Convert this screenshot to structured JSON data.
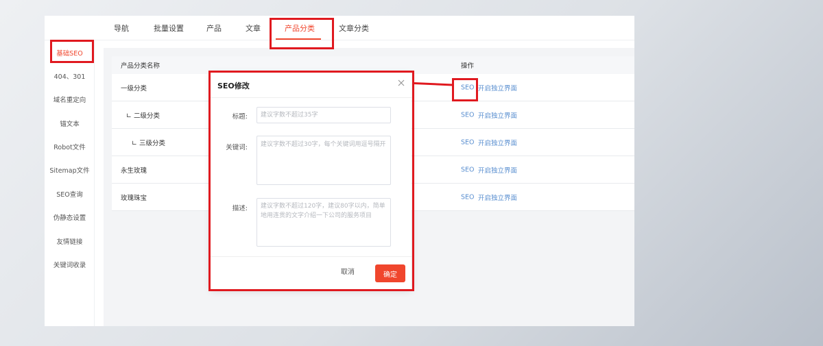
{
  "tabs": [
    {
      "label": "导航"
    },
    {
      "label": "批量设置"
    },
    {
      "label": "产品"
    },
    {
      "label": "文章"
    },
    {
      "label": "产品分类"
    },
    {
      "label": "文章分类"
    }
  ],
  "active_tab_index": 4,
  "sidebar": {
    "items": [
      {
        "label": "基础SEO"
      },
      {
        "label": "404、301"
      },
      {
        "label": "域名重定向"
      },
      {
        "label": "锚文本"
      },
      {
        "label": "Robot文件"
      },
      {
        "label": "Sitemap文件"
      },
      {
        "label": "SEO查询"
      },
      {
        "label": "伪静态设置"
      },
      {
        "label": "友情链接"
      },
      {
        "label": "关键词收录"
      }
    ],
    "active_index": 0
  },
  "table": {
    "headers": {
      "name": "产品分类名称",
      "action": "操作"
    },
    "rows": [
      {
        "name": "一级分类",
        "seo": "SEO",
        "open": "开启独立界面"
      },
      {
        "name": "∟ 二级分类",
        "seo": "SEO",
        "open": "开启独立界面"
      },
      {
        "name": "∟ 三级分类",
        "seo": "SEO",
        "open": "开启独立界面"
      },
      {
        "name": "永生玫瑰",
        "seo": "SEO",
        "open": "开启独立界面"
      },
      {
        "name": "玫瑰珠宝",
        "seo": "SEO",
        "open": "开启独立界面"
      }
    ]
  },
  "modal": {
    "title": "SEO修改",
    "title_label": "标题:",
    "title_placeholder": "建议字数不超过35字",
    "keywords_label": "关键词:",
    "keywords_placeholder": "建议字数不超过30字，每个关键词用逗号隔开",
    "desc_label": "描述:",
    "desc_placeholder": "建议字数不超过120字，建议80字以内，简单地用连贯的文字介绍一下公司的服务项目",
    "cancel": "取消",
    "confirm": "确定"
  },
  "colors": {
    "accent": "#f0462d",
    "highlight_box": "#e0191f",
    "link": "#5a8fd0"
  }
}
